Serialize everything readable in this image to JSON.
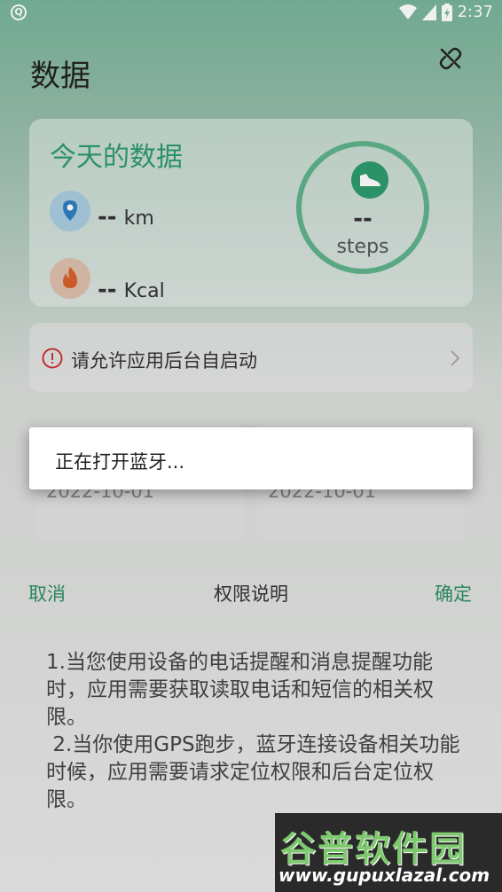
{
  "status_bar": {
    "time": "2:37"
  },
  "header": {
    "title": "数据"
  },
  "today": {
    "title": "今天的数据",
    "distance": {
      "value": "--",
      "unit": "km"
    },
    "calories": {
      "value": "--",
      "unit": "Kcal"
    },
    "steps": {
      "value": "--",
      "unit": "steps"
    }
  },
  "permission_row": {
    "label": "请允许应用后台自启动"
  },
  "dates": [
    "2022-10-01",
    "2022-10-01"
  ],
  "sheet": {
    "cancel_label": "取消",
    "title": "权限说明",
    "confirm_label": "确定",
    "body": "1.当您使用设备的电话提醒和消息提醒功能时，应用需要获取读取电话和短信的相关权限。\n 2.当你使用GPS跑步，蓝牙连接设备相关功能时候，应用需要请求定位权限和后台定位权限。"
  },
  "dialog": {
    "message": "正在打开蓝牙..."
  },
  "watermark": {
    "brand": "谷普软件园",
    "url": "www.gupuxlazal.com"
  },
  "colors": {
    "accent": "#2e9b6e",
    "ring": "#5fb38c"
  },
  "icons": [
    "link-off-icon",
    "location-pin-icon",
    "flame-icon",
    "shoe-icon",
    "warning-icon",
    "chevron-right-icon",
    "wifi-icon",
    "signal-icon",
    "battery-icon"
  ]
}
